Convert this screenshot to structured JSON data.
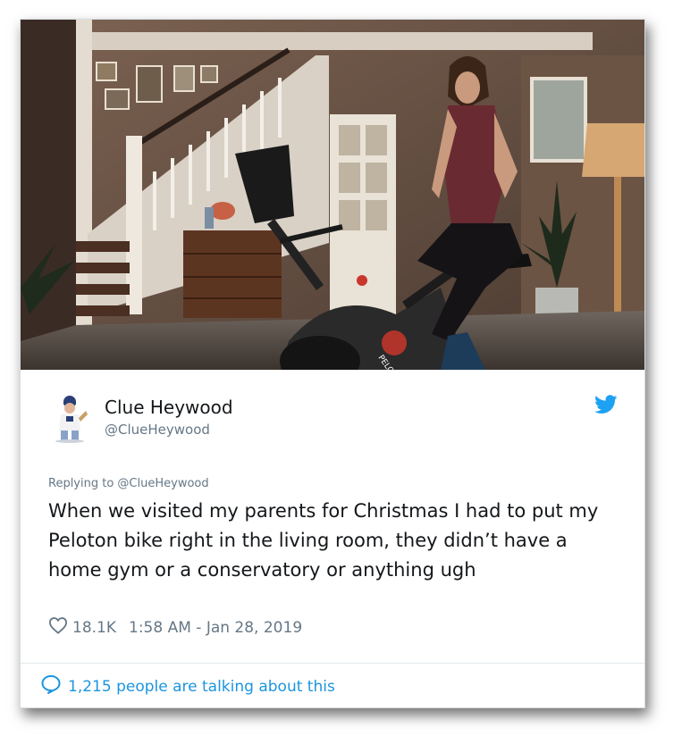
{
  "tweet": {
    "image_alt": "Peloton bike in living room",
    "bike_brand_label": "PELOTON",
    "user_name": "Clue Heywood",
    "user_handle": "@ClueHeywood",
    "replying_to": "Replying to @ClueHeywood",
    "text": "When we visited my parents for Christmas I had to put my Peloton bike right in the living room, they didn’t have a home gym or a conservatory or anything ugh",
    "likes": "18.1K",
    "timestamp": "1:58 AM - Jan 28, 2019",
    "talking_about": "1,215 people are talking about this"
  },
  "icons": {
    "heart": "heart-icon",
    "bird": "twitter-bird-icon",
    "bubble": "speech-bubble-icon"
  },
  "colors": {
    "name": "#14171a",
    "muted": "#657786",
    "link": "#1b95e0",
    "twitter_blue": "#1da1f2",
    "divider": "#e1e8ed"
  }
}
